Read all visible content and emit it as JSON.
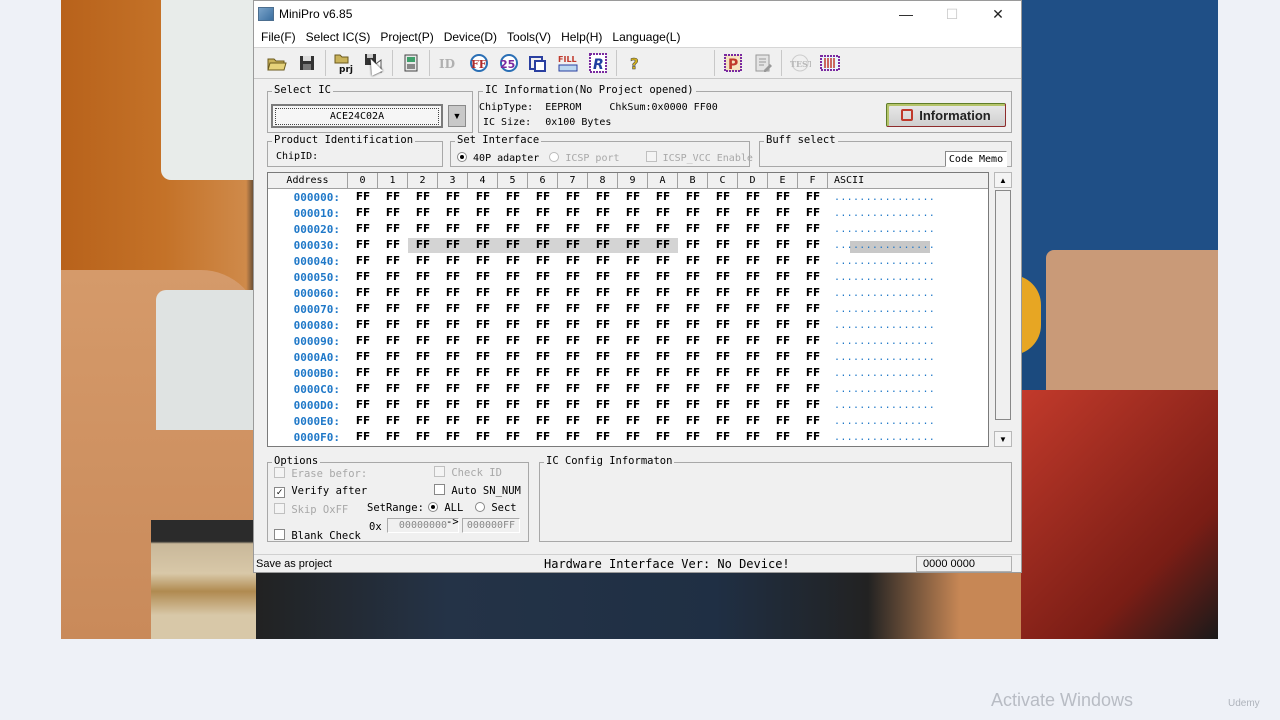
{
  "window": {
    "title": "MiniPro v6.85",
    "controls": {
      "minimize": "—",
      "maximize": "☐",
      "close": "✕"
    }
  },
  "menu": [
    "File(F)",
    "Select IC(S)",
    "Project(P)",
    "Device(D)",
    "Tools(V)",
    "Help(H)",
    "Language(L)"
  ],
  "toolbar": {
    "buttons": [
      {
        "name": "open-file",
        "icon": "folder-open-icon"
      },
      {
        "name": "save-file",
        "icon": "floppy-icon"
      },
      {
        "name": "open-project",
        "icon": "folder-prj-icon",
        "label": "prj"
      },
      {
        "name": "save-as-project",
        "icon": "floppy-arrow-icon"
      },
      {
        "name": "select-ic",
        "icon": "chip-select-icon"
      },
      {
        "name": "read-id",
        "icon": "id-icon",
        "label": "ID"
      },
      {
        "name": "read",
        "icon": "read-ff-icon",
        "label": "FF"
      },
      {
        "name": "verify",
        "icon": "verify-25-icon",
        "label": "25"
      },
      {
        "name": "blank-check",
        "icon": "blank-check-icon"
      },
      {
        "name": "fill",
        "icon": "fill-icon",
        "label": "FILL"
      },
      {
        "name": "read-chip",
        "icon": "read-r-icon",
        "label": "R"
      },
      {
        "name": "help",
        "icon": "help-icon",
        "label": "?"
      },
      {
        "name": "program",
        "icon": "program-p-icon",
        "label": "P"
      },
      {
        "name": "edit",
        "icon": "edit-icon"
      },
      {
        "name": "test",
        "icon": "test-icon",
        "label": "TEST"
      },
      {
        "name": "ic-test",
        "icon": "chip-test-icon"
      }
    ]
  },
  "select_ic": {
    "legend": "Select IC",
    "value": "ACE24C02A"
  },
  "ic_info": {
    "legend": "IC Information(No Project opened)",
    "chip_type_label": "ChipType:",
    "chip_type": "EEPROM",
    "checksum_label": "ChkSum:",
    "checksum": "0x0000 FF00",
    "size_label": "IC Size:",
    "size": "0x100 Bytes",
    "info_button": "Information"
  },
  "product_id": {
    "legend": "Product Identification",
    "chip_id_label": "ChipID:"
  },
  "set_interface": {
    "legend": "Set Interface",
    "options": [
      {
        "label": "40P adapter",
        "selected": true,
        "enabled": true
      },
      {
        "label": "ICSP port",
        "selected": false,
        "enabled": false
      }
    ],
    "icsp_vcc": {
      "label": "ICSP_VCC Enable",
      "checked": false,
      "enabled": false
    }
  },
  "buff_select": {
    "legend": "Buff select",
    "value": "Code Memo"
  },
  "hex_grid": {
    "headers": [
      "Address",
      "0",
      "1",
      "2",
      "3",
      "4",
      "5",
      "6",
      "7",
      "8",
      "9",
      "A",
      "B",
      "C",
      "D",
      "E",
      "F",
      "ASCII"
    ],
    "rows": [
      {
        "addr": "000000:",
        "bytes": [
          "FF",
          "FF",
          "FF",
          "FF",
          "FF",
          "FF",
          "FF",
          "FF",
          "FF",
          "FF",
          "FF",
          "FF",
          "FF",
          "FF",
          "FF",
          "FF"
        ],
        "ascii": "................"
      },
      {
        "addr": "000010:",
        "bytes": [
          "FF",
          "FF",
          "FF",
          "FF",
          "FF",
          "FF",
          "FF",
          "FF",
          "FF",
          "FF",
          "FF",
          "FF",
          "FF",
          "FF",
          "FF",
          "FF"
        ],
        "ascii": "................"
      },
      {
        "addr": "000020:",
        "bytes": [
          "FF",
          "FF",
          "FF",
          "FF",
          "FF",
          "FF",
          "FF",
          "FF",
          "FF",
          "FF",
          "FF",
          "FF",
          "FF",
          "FF",
          "FF",
          "FF"
        ],
        "ascii": "................"
      },
      {
        "addr": "000030:",
        "bytes": [
          "FF",
          "FF",
          "FF",
          "FF",
          "FF",
          "FF",
          "FF",
          "FF",
          "FF",
          "FF",
          "FF",
          "FF",
          "FF",
          "FF",
          "FF",
          "FF"
        ],
        "ascii": "................",
        "selected_range": [
          2,
          10
        ]
      },
      {
        "addr": "000040:",
        "bytes": [
          "FF",
          "FF",
          "FF",
          "FF",
          "FF",
          "FF",
          "FF",
          "FF",
          "FF",
          "FF",
          "FF",
          "FF",
          "FF",
          "FF",
          "FF",
          "FF"
        ],
        "ascii": "................"
      },
      {
        "addr": "000050:",
        "bytes": [
          "FF",
          "FF",
          "FF",
          "FF",
          "FF",
          "FF",
          "FF",
          "FF",
          "FF",
          "FF",
          "FF",
          "FF",
          "FF",
          "FF",
          "FF",
          "FF"
        ],
        "ascii": "................"
      },
      {
        "addr": "000060:",
        "bytes": [
          "FF",
          "FF",
          "FF",
          "FF",
          "FF",
          "FF",
          "FF",
          "FF",
          "FF",
          "FF",
          "FF",
          "FF",
          "FF",
          "FF",
          "FF",
          "FF"
        ],
        "ascii": "................"
      },
      {
        "addr": "000070:",
        "bytes": [
          "FF",
          "FF",
          "FF",
          "FF",
          "FF",
          "FF",
          "FF",
          "FF",
          "FF",
          "FF",
          "FF",
          "FF",
          "FF",
          "FF",
          "FF",
          "FF"
        ],
        "ascii": "................"
      },
      {
        "addr": "000080:",
        "bytes": [
          "FF",
          "FF",
          "FF",
          "FF",
          "FF",
          "FF",
          "FF",
          "FF",
          "FF",
          "FF",
          "FF",
          "FF",
          "FF",
          "FF",
          "FF",
          "FF"
        ],
        "ascii": "................"
      },
      {
        "addr": "000090:",
        "bytes": [
          "FF",
          "FF",
          "FF",
          "FF",
          "FF",
          "FF",
          "FF",
          "FF",
          "FF",
          "FF",
          "FF",
          "FF",
          "FF",
          "FF",
          "FF",
          "FF"
        ],
        "ascii": "................"
      },
      {
        "addr": "0000A0:",
        "bytes": [
          "FF",
          "FF",
          "FF",
          "FF",
          "FF",
          "FF",
          "FF",
          "FF",
          "FF",
          "FF",
          "FF",
          "FF",
          "FF",
          "FF",
          "FF",
          "FF"
        ],
        "ascii": "................"
      },
      {
        "addr": "0000B0:",
        "bytes": [
          "FF",
          "FF",
          "FF",
          "FF",
          "FF",
          "FF",
          "FF",
          "FF",
          "FF",
          "FF",
          "FF",
          "FF",
          "FF",
          "FF",
          "FF",
          "FF"
        ],
        "ascii": "................"
      },
      {
        "addr": "0000C0:",
        "bytes": [
          "FF",
          "FF",
          "FF",
          "FF",
          "FF",
          "FF",
          "FF",
          "FF",
          "FF",
          "FF",
          "FF",
          "FF",
          "FF",
          "FF",
          "FF",
          "FF"
        ],
        "ascii": "................"
      },
      {
        "addr": "0000D0:",
        "bytes": [
          "FF",
          "FF",
          "FF",
          "FF",
          "FF",
          "FF",
          "FF",
          "FF",
          "FF",
          "FF",
          "FF",
          "FF",
          "FF",
          "FF",
          "FF",
          "FF"
        ],
        "ascii": "................"
      },
      {
        "addr": "0000E0:",
        "bytes": [
          "FF",
          "FF",
          "FF",
          "FF",
          "FF",
          "FF",
          "FF",
          "FF",
          "FF",
          "FF",
          "FF",
          "FF",
          "FF",
          "FF",
          "FF",
          "FF"
        ],
        "ascii": "................"
      },
      {
        "addr": "0000F0:",
        "bytes": [
          "FF",
          "FF",
          "FF",
          "FF",
          "FF",
          "FF",
          "FF",
          "FF",
          "FF",
          "FF",
          "FF",
          "FF",
          "FF",
          "FF",
          "FF",
          "FF"
        ],
        "ascii": "................"
      }
    ]
  },
  "options": {
    "legend": "Options",
    "erase_before": {
      "label": "Erase befor:",
      "checked": false,
      "enabled": false
    },
    "verify_after": {
      "label": "Verify after",
      "checked": true,
      "enabled": true
    },
    "skip_0xff": {
      "label": "Skip OxFF",
      "checked": false,
      "enabled": false
    },
    "blank_check": {
      "label": "Blank Check",
      "checked": false,
      "enabled": true
    },
    "check_id": {
      "label": "Check ID",
      "checked": false,
      "enabled": false
    },
    "auto_sn": {
      "label": "Auto SN_NUM",
      "checked": false,
      "enabled": true
    },
    "set_range_label": "SetRange:",
    "range_all": "ALL",
    "range_sect": "Sect",
    "range_selected": "ALL",
    "hex_prefix": "0x",
    "range_from": "00000000",
    "range_arrow": "->",
    "range_to": "000000FF"
  },
  "ic_config": {
    "legend": "IC Config Informaton"
  },
  "status": {
    "hint": "Save as project",
    "hardware": "Hardware Interface Ver: No Device!",
    "code": "0000 0000"
  },
  "overlay": {
    "activate_windows": "Activate Windows",
    "watermark": "Udemy"
  },
  "colors": {
    "address": "#1f78c8",
    "ascii": "#1f78c8",
    "selection": "#d4d4d4"
  }
}
